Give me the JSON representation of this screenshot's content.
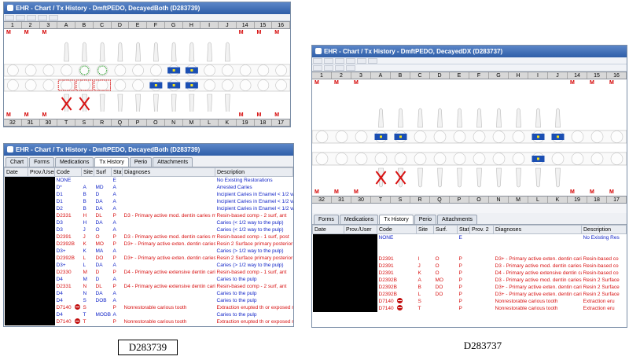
{
  "colors": {
    "title_bar": "#2f5ea8",
    "red_text": "#d81313",
    "blue_text": "#1326c8",
    "caries_red": "#d81313",
    "restoration_blue": "#1b4fb3"
  },
  "win1": {
    "title": "EHR - Chart / Tx History - DmftPEDO, DecayedBoth (D283739)",
    "top_numbers": [
      "1",
      "2",
      "3",
      "A",
      "B",
      "C",
      "D",
      "E",
      "F",
      "G",
      "H",
      "I",
      "J",
      "14",
      "15",
      "16"
    ],
    "top_marks": [
      "M",
      "M",
      "M",
      "",
      "",
      "",
      "",
      "",
      "",
      "",
      "",
      "",
      "",
      "M",
      "M",
      "M"
    ],
    "bottom_marks": [
      "M",
      "M",
      "M",
      "",
      "",
      "",
      "",
      "",
      "",
      "",
      "",
      "",
      "",
      "M",
      "M",
      "M"
    ],
    "bottom_numbers": [
      "32",
      "31",
      "30",
      "T",
      "S",
      "R",
      "Q",
      "P",
      "O",
      "N",
      "M",
      "L",
      "K",
      "19",
      "18",
      "17"
    ]
  },
  "win2": {
    "title": "EHR - Chart / Tx History - DmftPEDO, DecayedBoth (D283739)",
    "tabs": [
      "Chart",
      "Forms",
      "Medications",
      "Tx History",
      "Perio",
      "Attachments"
    ],
    "headers": [
      "Date",
      "Prov./User",
      "Code",
      "Site",
      "Surf",
      "Stat",
      "Diagnoses",
      "Description"
    ],
    "rows": [
      {
        "color": "blue",
        "code": "NONE",
        "site": "",
        "surf": "",
        "stat": "E",
        "diag": "",
        "desc": "No Existing Restorations"
      },
      {
        "color": "blue",
        "code": "D*",
        "site": "A",
        "surf": "MD",
        "stat": "A",
        "diag": "",
        "desc": "Arrested Caries"
      },
      {
        "color": "blue",
        "code": "D1",
        "site": "B",
        "surf": "D",
        "stat": "A",
        "diag": "",
        "desc": "Incipient Caries in Enamel < 1/2 wa"
      },
      {
        "color": "blue",
        "code": "D1",
        "site": "B",
        "surf": "DA",
        "stat": "A",
        "diag": "",
        "desc": "Incipient Caries in Enamel < 1/2 wa"
      },
      {
        "color": "blue",
        "code": "D2",
        "site": "B",
        "surf": "DA",
        "stat": "A",
        "diag": "",
        "desc": "Incipient Caries in Enamel < 1/2 wa"
      },
      {
        "color": "red",
        "code": "D2331",
        "site": "H",
        "surf": "DL",
        "stat": "P",
        "diag": "D3 - Primary active mod. dentin caries middle 1/3",
        "desc": "Resin-based comp - 2 surf, ant"
      },
      {
        "color": "blue",
        "code": "D3",
        "site": "H",
        "surf": "DA",
        "stat": "A",
        "diag": "",
        "desc": "Caries (< 1/2 way to the pulp)"
      },
      {
        "color": "blue",
        "code": "D3",
        "site": "J",
        "surf": "O",
        "stat": "A",
        "diag": "",
        "desc": "Caries (< 1/2 way to the pulp)"
      },
      {
        "color": "red",
        "code": "D2391",
        "site": "J",
        "surf": "O",
        "stat": "P",
        "diag": "D3 - Primary active mod. dentin caries middle 1/3",
        "desc": "Resin-based comp - 1 surf, post"
      },
      {
        "color": "red",
        "code": "D2392B",
        "site": "K",
        "surf": "MO",
        "stat": "P",
        "diag": "D3+ - Primary active exten. dentin caries inner pulpal 1/3",
        "desc": "Resin 2 Surface primary posterior th"
      },
      {
        "color": "blue",
        "code": "D3+",
        "site": "K",
        "surf": "MA",
        "stat": "A",
        "diag": "",
        "desc": "Caries (> 1/2 way to the pulp)"
      },
      {
        "color": "red",
        "code": "D2392B",
        "site": "L",
        "surf": "DO",
        "stat": "P",
        "diag": "D3+ - Primary active exten. dentin caries inner pulpal 1/3",
        "desc": "Resin 2 Surface primary posterior th"
      },
      {
        "color": "blue",
        "code": "D3+",
        "site": "L",
        "surf": "DA",
        "stat": "A",
        "diag": "",
        "desc": "Caries (> 1/2 way to the pulp)"
      },
      {
        "color": "red",
        "code": "D2330",
        "site": "M",
        "surf": "D",
        "stat": "P",
        "diag": "D4 - Primary active extensive dentin caries to the pulp",
        "desc": "Resin-based comp - 1 surf, ant"
      },
      {
        "color": "blue",
        "code": "D4",
        "site": "M",
        "surf": "D",
        "stat": "A",
        "diag": "",
        "desc": "Caries to the pulp"
      },
      {
        "color": "red",
        "code": "D2331",
        "site": "N",
        "surf": "DL",
        "stat": "P",
        "diag": "D4 - Primary active extensive dentin caries to the pulp",
        "desc": "Resin-based comp - 2 surf, ant"
      },
      {
        "color": "blue",
        "code": "D4",
        "site": "N",
        "surf": "DA",
        "stat": "A",
        "diag": "",
        "desc": "Caries to the pulp"
      },
      {
        "color": "blue",
        "code": "D4",
        "site": "S",
        "surf": "DOB",
        "stat": "A",
        "diag": "",
        "desc": "Caries to the pulp"
      },
      {
        "color": "red",
        "code": "D7140",
        "icon": true,
        "site": "S",
        "surf": "",
        "stat": "P",
        "diag": "Nonrestorable carious tooth",
        "desc": "Extraction erupted th or exposed ro"
      },
      {
        "color": "blue",
        "code": "D4",
        "site": "T",
        "surf": "MODB",
        "stat": "A",
        "diag": "",
        "desc": "Caries to the pulp"
      },
      {
        "color": "red",
        "code": "D7140",
        "icon": true,
        "site": "T",
        "surf": "",
        "stat": "P",
        "diag": "Nonrestorable carious tooth",
        "desc": "Extraction erupted th or exposed ro"
      }
    ]
  },
  "win3": {
    "title": "EHR - Chart / Tx History - DmftPEDO, DecayedDX (D283737)",
    "top_numbers": [
      "1",
      "2",
      "3",
      "A",
      "B",
      "C",
      "D",
      "E",
      "F",
      "G",
      "H",
      "I",
      "J",
      "14",
      "15",
      "16"
    ],
    "top_marks": [
      "M",
      "M",
      "M",
      "",
      "",
      "",
      "",
      "",
      "",
      "",
      "",
      "",
      "",
      "M",
      "M",
      "M"
    ],
    "bottom_marks": [
      "M",
      "M",
      "M",
      "",
      "",
      "",
      "",
      "",
      "",
      "",
      "",
      "",
      "",
      "M",
      "M",
      "M"
    ],
    "bottom_numbers": [
      "32",
      "31",
      "30",
      "T",
      "S",
      "R",
      "Q",
      "P",
      "O",
      "N",
      "M",
      "L",
      "K",
      "19",
      "18",
      "17"
    ],
    "tabs": [
      "Forms",
      "Medications",
      "Tx History",
      "Perio",
      "Attachments"
    ],
    "headers": [
      "Date",
      "Prov./User",
      "Code",
      "Site",
      "Surf.",
      "Stat",
      "Prov. 2",
      "Diagnoses",
      "Description"
    ],
    "rows": [
      {
        "color": "blue",
        "code": "NONE",
        "site": "",
        "surf": "",
        "stat": "E",
        "diag": "",
        "desc": "No Existing Res"
      },
      {
        "color": "red",
        "code": "",
        "site": "",
        "surf": "",
        "stat": "",
        "diag": "",
        "desc": ""
      },
      {
        "color": "red",
        "code": "",
        "site": "",
        "surf": "",
        "stat": "",
        "diag": "",
        "desc": ""
      },
      {
        "color": "red",
        "code": "D2391",
        "site": "I",
        "surf": "O",
        "stat": "P",
        "diag": "D3+ - Primary active exten. dentin caries i",
        "desc": "Resin-based co"
      },
      {
        "color": "red",
        "code": "D2391",
        "site": "J",
        "surf": "O",
        "stat": "P",
        "diag": "D3 - Primary active mod. dentin caries m",
        "desc": "Resin-based co"
      },
      {
        "color": "red",
        "code": "D2391",
        "site": "K",
        "surf": "O",
        "stat": "P",
        "diag": "D4 - Primary active extensive dentin caries",
        "desc": "Resin-based co"
      },
      {
        "color": "red",
        "code": "D2392B",
        "site": "A",
        "surf": "MO",
        "stat": "P",
        "diag": "D3 - Primary active mod. dentin caries m",
        "desc": "Resin 2 Surface"
      },
      {
        "color": "red",
        "code": "D2392B",
        "site": "B",
        "surf": "DO",
        "stat": "P",
        "diag": "D3+ - Primary active exten. dentin caries i",
        "desc": "Resin 2 Surface"
      },
      {
        "color": "red",
        "code": "D2392B",
        "site": "L",
        "surf": "DO",
        "stat": "P",
        "diag": "D3+ - Primary active exten. dentin caries i",
        "desc": "Resin 2 Surface"
      },
      {
        "color": "red",
        "code": "D7140",
        "icon": true,
        "site": "S",
        "surf": "",
        "stat": "P",
        "diag": "Nonrestorable carious tooth",
        "desc": "Extraction eru"
      },
      {
        "color": "red",
        "code": "D7140",
        "icon": true,
        "site": "T",
        "surf": "",
        "stat": "P",
        "diag": "Nonrestorable carious tooth",
        "desc": "Extraction eru"
      }
    ]
  },
  "captions": {
    "left": "D283739",
    "right": "D283737"
  }
}
